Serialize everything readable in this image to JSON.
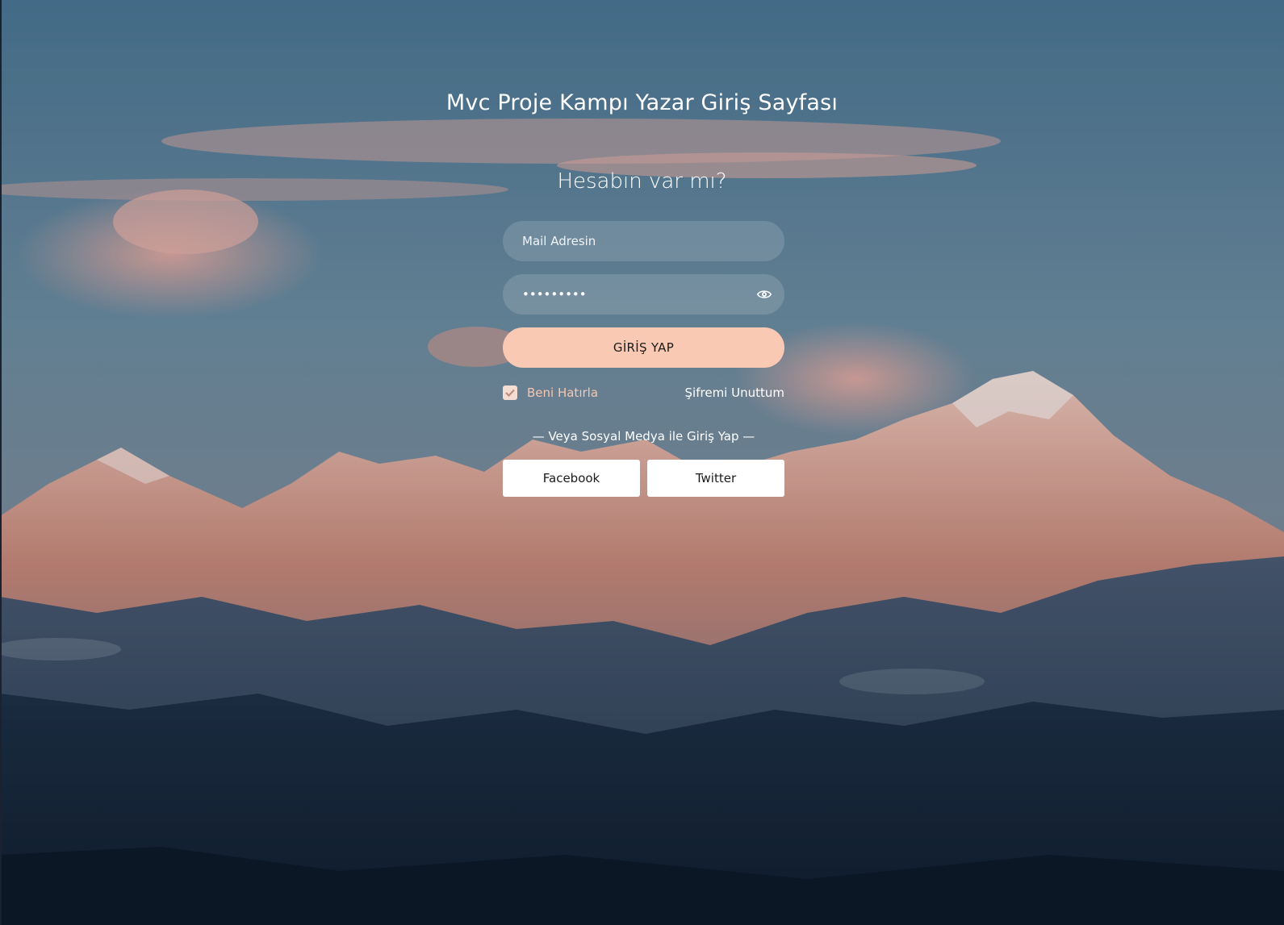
{
  "page": {
    "title": "Mvc Proje Kampı Yazar Giriş Sayfası",
    "subtitle": "Hesabın var mı?"
  },
  "form": {
    "email": {
      "placeholder": "Mail Adresin",
      "value": ""
    },
    "password": {
      "value": "*********",
      "toggle_icon": "eye-icon"
    },
    "login_label": "GİRİŞ YAP",
    "remember": {
      "label": "Beni Hatırla",
      "checked": true
    },
    "forgot_label": "Şifremi Unuttum",
    "social_divider": "— Veya Sosyal Medya ile Giriş Yap —",
    "social_buttons": {
      "facebook": "Facebook",
      "twitter": "Twitter"
    }
  },
  "colors": {
    "accent": "#f9c9b4",
    "remember_text": "#f7c6b0"
  }
}
